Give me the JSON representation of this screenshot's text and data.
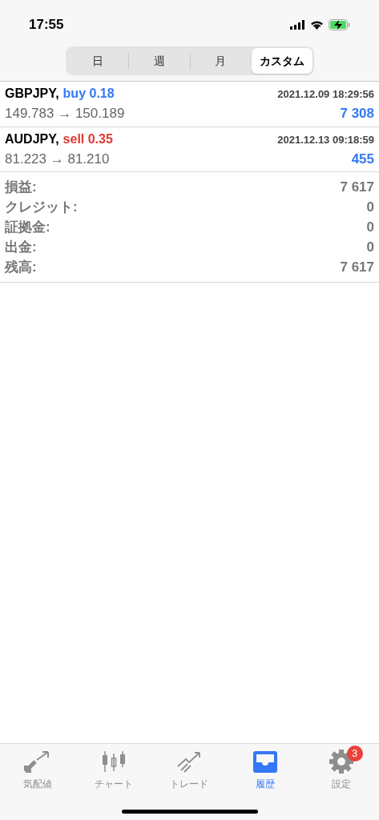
{
  "status_bar": {
    "time": "17:55"
  },
  "period_tabs": [
    {
      "label": "日",
      "selected": false
    },
    {
      "label": "週",
      "selected": false
    },
    {
      "label": "月",
      "selected": false
    },
    {
      "label": "カスタム",
      "selected": true
    }
  ],
  "trades": [
    {
      "symbol": "GBPJPY,",
      "side": "buy",
      "lots": "0.18",
      "time": "2021.12.09 18:29:56",
      "prices": "149.783 → 150.189",
      "profit": "7 308"
    },
    {
      "symbol": "AUDJPY,",
      "side": "sell",
      "lots": "0.35",
      "time": "2021.12.13 09:18:59",
      "prices": "81.223 → 81.210",
      "profit": "455"
    }
  ],
  "summary": [
    {
      "label": "損益:",
      "value": "7 617"
    },
    {
      "label": "クレジット:",
      "value": "0"
    },
    {
      "label": "証拠金:",
      "value": "0"
    },
    {
      "label": "出金:",
      "value": "0"
    },
    {
      "label": "残高:",
      "value": "7 617"
    }
  ],
  "tab_bar": [
    {
      "kind": "quotes",
      "label": "気配値",
      "selected": false
    },
    {
      "kind": "chart",
      "label": "チャート",
      "selected": false
    },
    {
      "kind": "trade",
      "label": "トレード",
      "selected": false
    },
    {
      "kind": "history",
      "label": "履歴",
      "selected": true
    },
    {
      "kind": "settings",
      "label": "設定",
      "selected": false,
      "badge": "3"
    }
  ]
}
